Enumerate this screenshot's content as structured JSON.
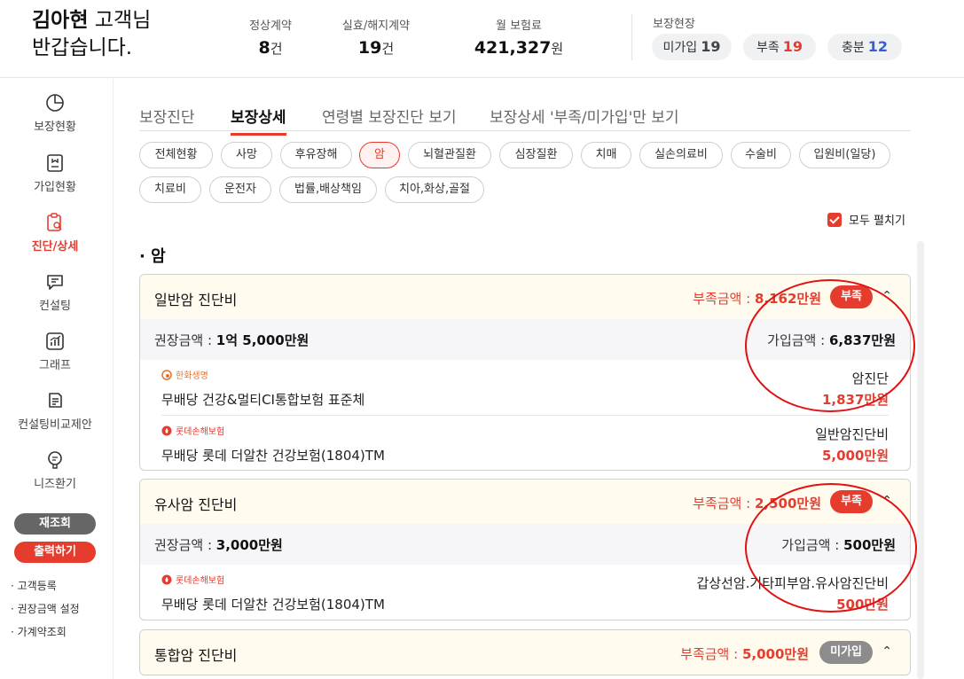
{
  "header": {
    "customer_name": "김아현",
    "customer_suffix": " 고객님",
    "greeting": "반갑습니다.",
    "stats": [
      {
        "label": "정상계약",
        "value": "8",
        "unit": "건"
      },
      {
        "label": "실효/해지계약",
        "value": "19",
        "unit": "건"
      },
      {
        "label": "월 보험료",
        "value": "421,327",
        "unit": "원"
      }
    ],
    "coverage_title": "보장현장",
    "coverage": [
      {
        "label": "미가입",
        "count": "19",
        "color": "#444444"
      },
      {
        "label": "부족",
        "count": "19",
        "color": "#e63c2e"
      },
      {
        "label": "충분",
        "count": "12",
        "color": "#3a5bd9"
      }
    ]
  },
  "sidebar": {
    "items": [
      {
        "label": "보장현황",
        "icon": "pie-chart-icon"
      },
      {
        "label": "가입현황",
        "icon": "document-icon"
      },
      {
        "label": "진단/상세",
        "icon": "clipboard-search-icon"
      },
      {
        "label": "컨설팅",
        "icon": "chat-icon"
      },
      {
        "label": "그래프",
        "icon": "graph-icon"
      },
      {
        "label": "컨설팅비교제안",
        "icon": "compare-icon"
      },
      {
        "label": "니즈환기",
        "icon": "monitor-chat-icon"
      }
    ],
    "buttons": {
      "refresh": "재조회",
      "print": "출력하기"
    },
    "links": [
      "· 고객등록",
      "· 권장금액 설정",
      "· 가계약조회"
    ]
  },
  "tabs": [
    "보장진단",
    "보장상세",
    "연령별 보장진단 보기",
    "보장상세 '부족/미가입'만 보기"
  ],
  "chips": [
    "전체현황",
    "사망",
    "후유장해",
    "암",
    "뇌혈관질환",
    "심장질환",
    "치매",
    "실손의료비",
    "수술비",
    "입원비(일당)",
    "치료비",
    "운전자",
    "법률,배상책임",
    "치아,화상,골절"
  ],
  "expand_all": "모두 펼치기",
  "section_title": "· 암",
  "cards": [
    {
      "name": "일반암 진단비",
      "short_label": "부족금액 : ",
      "short_amount": "8,162만원",
      "badge": "부족",
      "recommended_label": "권장금액 : ",
      "recommended": "1억 5,000만원",
      "joined_label": "가입금액 : ",
      "joined": "6,837만원",
      "products": [
        {
          "insurer": "한화생명",
          "name": "무배당 건강&멀티CI통합보험 표준체",
          "coverage": "암진단",
          "amount": "1,837만원"
        },
        {
          "insurer": "롯데손해보험",
          "name": "무배당 롯데 더알찬 건강보험(1804)TM",
          "coverage": "일반암진단비",
          "amount": "5,000만원"
        }
      ]
    },
    {
      "name": "유사암 진단비",
      "short_label": "부족금액 : ",
      "short_amount": "2,500만원",
      "badge": "부족",
      "recommended_label": "권장금액 : ",
      "recommended": "3,000만원",
      "joined_label": "가입금액 : ",
      "joined": "500만원",
      "products": [
        {
          "insurer": "롯데손해보험",
          "name": "무배당 롯데 더알찬 건강보험(1804)TM",
          "coverage": "갑상선암.기타피부암.유사암진단비",
          "amount": "500만원"
        }
      ]
    },
    {
      "name": "통합암 진단비",
      "short_label": "부족금액 : ",
      "short_amount": "5,000만원",
      "badge": "미가입"
    }
  ]
}
